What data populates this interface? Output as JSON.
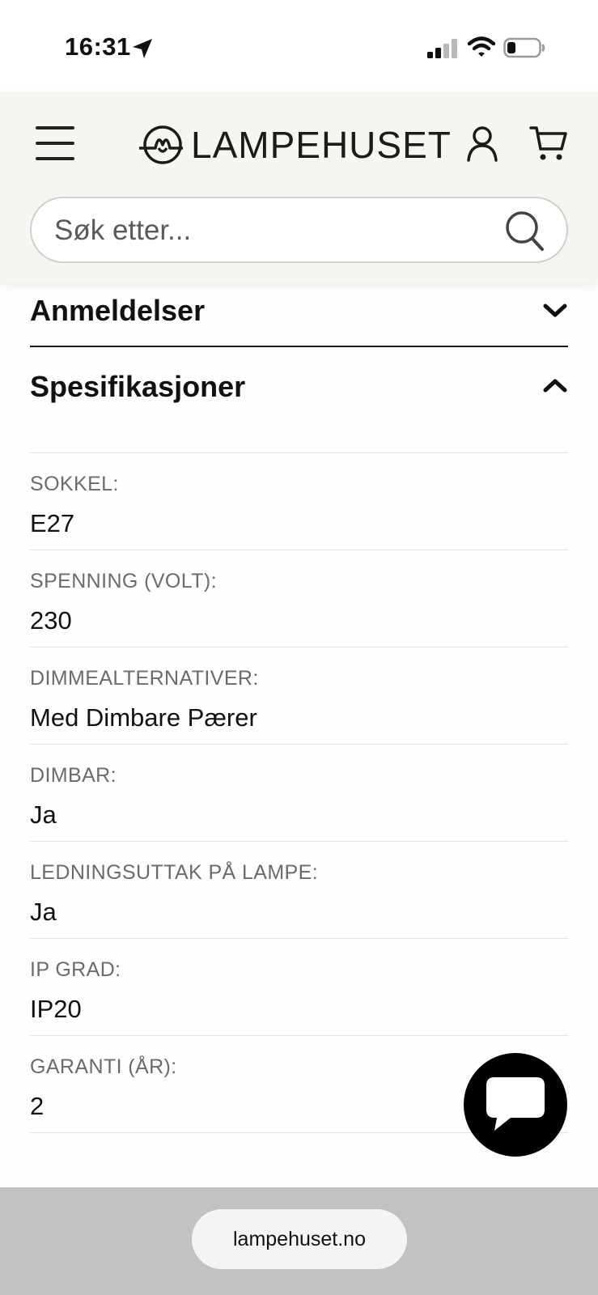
{
  "status_bar": {
    "time": "16:31",
    "icons": [
      "location-arrow-icon",
      "cellular-signal-icon",
      "wifi-icon",
      "battery-icon"
    ]
  },
  "header": {
    "logo_text": "LAMPEHUSET",
    "icons": [
      "menu-icon",
      "account-icon",
      "cart-icon"
    ]
  },
  "search": {
    "placeholder": "Søk etter...",
    "value": ""
  },
  "accordion": {
    "reviews_title": "Anmeldelser",
    "reviews_state": "collapsed",
    "specs_title": "Spesifikasjoner",
    "specs_state": "expanded"
  },
  "specs": [
    {
      "label": "SOKKEL:",
      "value": "E27"
    },
    {
      "label": "SPENNING (VOLT):",
      "value": "230"
    },
    {
      "label": "DIMMEALTERNATIVER:",
      "value": "Med Dimbare Pærer"
    },
    {
      "label": "DIMBAR:",
      "value": "Ja"
    },
    {
      "label": "LEDNINGSUTTAK PÅ LAMPE:",
      "value": "Ja"
    },
    {
      "label": "IP GRAD:",
      "value": "IP20"
    },
    {
      "label": "GARANTI (ÅR):",
      "value": "2"
    }
  ],
  "chat": {
    "icon": "chat-bubble-icon"
  },
  "browser": {
    "url": "lampehuset.no"
  },
  "colors": {
    "header_bg": "#f7f5f0",
    "text": "#111111",
    "muted_label": "#6b6b6b",
    "divider": "#e3e3e3",
    "chat_bg": "#000000",
    "browser_bar": "#c2c2c2"
  }
}
